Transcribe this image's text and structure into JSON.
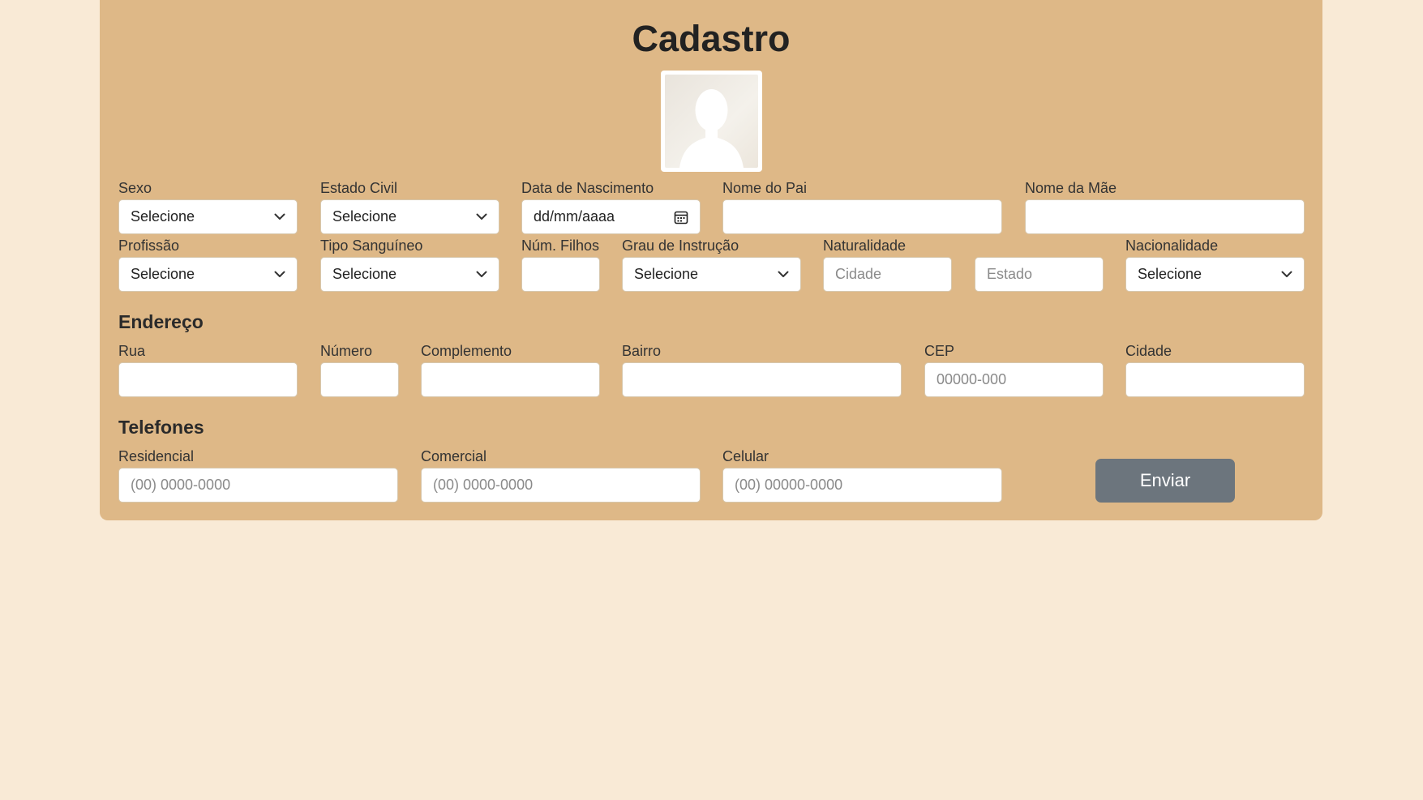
{
  "page": {
    "title": "Cadastro",
    "avatar_icon": "person-silhouette-icon",
    "colors": {
      "background": "#f9ead6",
      "card": "#deb887",
      "button": "#6c757d"
    }
  },
  "personal": {
    "sexo": {
      "label": "Sexo",
      "value": "Selecione"
    },
    "estado_civil": {
      "label": "Estado Civil",
      "value": "Selecione"
    },
    "nascimento": {
      "label": "Data de Nascimento",
      "placeholder": "dd/mm/aaaa",
      "icon": "calendar-icon"
    },
    "nome_pai": {
      "label": "Nome do Pai",
      "value": ""
    },
    "nome_mae": {
      "label": "Nome da Mãe",
      "value": ""
    },
    "profissao": {
      "label": "Profissão",
      "value": "Selecione"
    },
    "tipo_sanguineo": {
      "label": "Tipo Sanguíneo",
      "value": "Selecione"
    },
    "num_filhos": {
      "label": "Núm. Filhos",
      "value": ""
    },
    "grau_instrucao": {
      "label": "Grau de Instrução",
      "value": "Selecione"
    },
    "naturalidade": {
      "label": "Naturalidade",
      "cidade_placeholder": "Cidade",
      "estado_placeholder": "Estado"
    },
    "nacionalidade": {
      "label": "Nacionalidade",
      "value": "Selecione"
    }
  },
  "endereco": {
    "heading": "Endereço",
    "rua": {
      "label": "Rua",
      "value": ""
    },
    "numero": {
      "label": "Número",
      "value": ""
    },
    "complemento": {
      "label": "Complemento",
      "value": ""
    },
    "bairro": {
      "label": "Bairro",
      "value": ""
    },
    "cep": {
      "label": "CEP",
      "placeholder": "00000-000"
    },
    "cidade": {
      "label": "Cidade",
      "value": ""
    }
  },
  "telefones": {
    "heading": "Telefones",
    "residencial": {
      "label": "Residencial",
      "placeholder": "(00) 0000-0000"
    },
    "comercial": {
      "label": "Comercial",
      "placeholder": "(00) 0000-0000"
    },
    "celular": {
      "label": "Celular",
      "placeholder": "(00) 00000-0000"
    }
  },
  "actions": {
    "submit_label": "Enviar"
  }
}
